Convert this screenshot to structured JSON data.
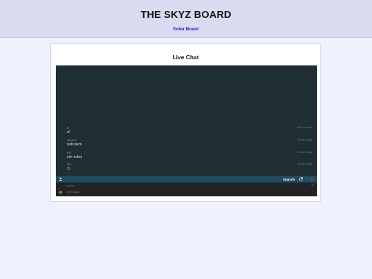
{
  "header": {
    "title": "THE SKYZ BOARD",
    "enter_link": "Enter Board"
  },
  "card": {
    "title": "Live Chat"
  },
  "chat": {
    "messages": [
      {
        "name": "ol",
        "text": "ol",
        "time": "16 hours ago"
      },
      {
        "name": "neymar",
        "text": "tudo bem",
        "time": "16 hours ago"
      },
      {
        "name": "sim",
        "text": "sim estou",
        "time": "16 hours ago"
      },
      {
        "name": "sim",
        "text": "",
        "time": "16 hours ago",
        "icon": "power-icon"
      }
    ],
    "toolbar": {
      "upgrade_label": "Upgrade",
      "user_icon": "user-icon",
      "popout_icon": "external-link-icon",
      "info_icon": "info-icon"
    },
    "composer": {
      "name_placeholder": "name",
      "message_placeholder": "message",
      "name_counter": "30",
      "message_marker": "·",
      "settings_icon": "gear-icon"
    },
    "colors": {
      "chat_background": "#1f2d34",
      "toolbar_background": "#234a5e",
      "composer_background": "#232323",
      "link": "#1a1ad6",
      "page_background": "#eef2ff",
      "header_background": "#d9dbf0"
    }
  }
}
